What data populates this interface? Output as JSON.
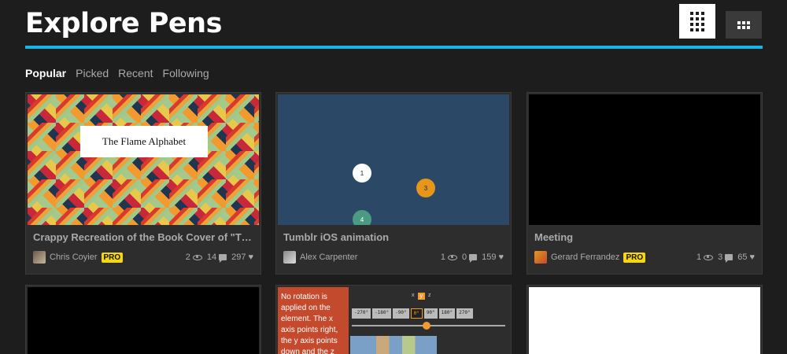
{
  "header": {
    "title": "Explore Pens",
    "view_large_icon": "grid-large-icon",
    "view_small_icon": "grid-small-icon",
    "accent_color": "#1ab5e8"
  },
  "filters": [
    "Popular",
    "Picked",
    "Recent",
    "Following"
  ],
  "cards": [
    {
      "title": "Crappy Recreation of the Book Cover of \"The Fla...",
      "thumb_text": "The Flame Alphabet",
      "author": "Chris Coyier",
      "pro": "PRO",
      "views": "2",
      "comments": "14",
      "likes": "297"
    },
    {
      "title": "Tumblr iOS animation",
      "bubbles": [
        "1",
        "3",
        "4"
      ],
      "author": "Alex Carpenter",
      "views": "1",
      "comments": "0",
      "likes": "159"
    },
    {
      "title": "Meeting",
      "author": "Gerard Ferrandez",
      "pro": "PRO",
      "views": "1",
      "comments": "3",
      "likes": "65"
    }
  ],
  "row2": {
    "rotation_text": "No rotation is applied on the element. The x axis points right, the y axis points down and the z axis",
    "axis_labels": [
      "x",
      "y",
      "z"
    ],
    "rotation_buttons": [
      "-270°",
      "-180°",
      "-90°",
      "0°",
      "90°",
      "180°",
      "270°"
    ]
  },
  "colors": {
    "pro_badge": "#f5d617",
    "tumblr_bg": "#2b4966",
    "bubble_orange": "#e8961a",
    "bubble_teal": "#4a9b82"
  }
}
